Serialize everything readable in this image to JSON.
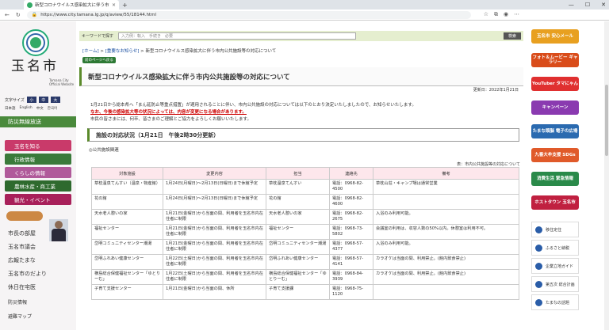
{
  "browser": {
    "tab_title": "新型コロナウイルス感染拡大に伴う市",
    "url": "https://www.city.tamana.lg.jp/q/aview/55/18144.html"
  },
  "site": {
    "city_name": "玉名市",
    "city_name_en": "Tamana City Official Website",
    "font_size_label": "文字サイズ",
    "font_sizes": [
      "小",
      "中",
      "大"
    ],
    "languages": [
      "日本語",
      "English",
      "中文",
      "한국어"
    ],
    "disaster_label": "防災無線放送"
  },
  "left_menu": [
    {
      "label": "玉名を知る",
      "color": "#c93a6a"
    },
    {
      "label": "行政情報",
      "color": "#3a7a3a"
    },
    {
      "label": "くらしの情報",
      "color": "#b05a9a"
    },
    {
      "label": "農林水産・商工業",
      "color": "#2e6a2e"
    },
    {
      "label": "観光・イベント",
      "color": "#a8205a"
    }
  ],
  "left_links": [
    "市長の部屋",
    "玉名市議会",
    "広報たまな",
    "玉名市のだより",
    "休日在宅医",
    "防災情報",
    "避難マップ"
  ],
  "search": {
    "label": "キーワードで探す",
    "placeholder": "入力例：転入　手続き　必要",
    "button": "検索"
  },
  "breadcrumb": {
    "home": "[ホーム]",
    "parent": "[重要なお知らせ]",
    "current": "新型コロナウイルス感染拡大に伴う市内公共施設等の対応について"
  },
  "to_start": "前のページへ戻る",
  "title": "新型コロナウイルス感染拡大に伴う市内公共施設等の対応について",
  "updated": "更新日：2022年1月21日",
  "intro": {
    "line1": "1月21日から総本県へ「まん延防止等重点措置」が適用されることに伴い、市内公共施設の対応については以下のとおり決定いたしましたので、お知らせいたします。",
    "line2": "なお、今後の感染拡大等の状況によっては、内容が変更になる場合があります。",
    "line3": "市民の皆さまには、何卒、皆さまのご理解とご協力をよろしくお願いいたします。"
  },
  "section_title": "施設の対応状況（1月21日　午後2時30分更新）",
  "sub_title": "◎公共施設関連",
  "table_caption": "表：市内公共施設等の対応について",
  "table": {
    "headers": [
      "対象施設",
      "変更内容",
      "担当",
      "連絡先",
      "備考"
    ],
    "rows": [
      [
        "草枕温泉てんすい（温泉・物産館）",
        "1月24日(月曜日)～2月13日(日曜日)まで休館予定",
        "草枕温泉てんすい",
        "電話：0968-82-4500",
        "草枕山荘・キャンプ場は通常営業"
      ],
      [
        "花の館",
        "1月24日(月曜日)～2月13日(日曜日)まで休館予定",
        "花の館",
        "電話：0968-82-4600",
        ""
      ],
      [
        "天水老人憩いの家",
        "1月21日(金曜日)から当面の間、利用者を玉名市内在住者に制限",
        "天水老人憩いの家",
        "電話：0968-82-2675",
        "入浴のみ利用可能。"
      ],
      [
        "福祉センター",
        "1月21日(金曜日)から当面の間、利用者を玉名市内在住者に制限",
        "福祉センター",
        "電話：0968-73-5802",
        "会議室の利用は、収容人数の50%以内。休憩室は利用不可。"
      ],
      [
        "岱明コミュニティセンター潮湯",
        "1月21日(金曜日)から当面の間、利用者を玉名市内在住者に制限",
        "岱明コミュニティセンター潮湯",
        "電話：0968-57-4377",
        "入浴のみ利用可能。"
      ],
      [
        "岱明ふれあい健康センター",
        "1月22日(土曜日)から当面の間、利用者を玉名市内在住者に制限",
        "岱明ふれあい健康センター",
        "電話：0968-57-4141",
        "カラオケは当面の間、利用禁止。(館内飲食禁止)"
      ],
      [
        "横島総合保健福祉センター「ゆとりーむ」",
        "1月22日(土曜日)から当面の間、利用者を玉名市内在住者に制限",
        "横島総合保健福祉センター「ゆとりーむ」",
        "電話：0968-84-3939",
        "カラオケは当面の間、利用禁止。(館内飲食禁止)"
      ],
      [
        "子育て支援センター",
        "1月21日(金曜日)から当面の間、休所",
        "子育て支援課",
        "電話：0968-75-1120",
        ""
      ]
    ]
  },
  "right_banners": [
    {
      "label": "玉名市 安心メール",
      "color": "#e8a020"
    },
    {
      "label": "フォト＆ムービー ギャラリー",
      "color": "#d94c1a"
    },
    {
      "label": "YouTuber タマにゃん",
      "color": "#e03030"
    },
    {
      "label": "キャンペーン",
      "color": "#8a3ab0"
    },
    {
      "label": "たまな頭脳 電子の広場",
      "color": "#2a6ab0"
    },
    {
      "label": "九番大牟支援 SDGs",
      "color": "#e05a2a"
    },
    {
      "label": "消費生活 緊急情報",
      "color": "#2a8a4a"
    },
    {
      "label": "ホストタウン 玉名市",
      "color": "#c02040"
    }
  ],
  "right_links": [
    "移住定住",
    "ふるさと納税",
    "企業立地ガイド",
    "第五次 総合計画",
    "たまなの話題"
  ],
  "colors": {
    "accent_green": "#5a8a2a",
    "table_header": "#fde7ec"
  }
}
